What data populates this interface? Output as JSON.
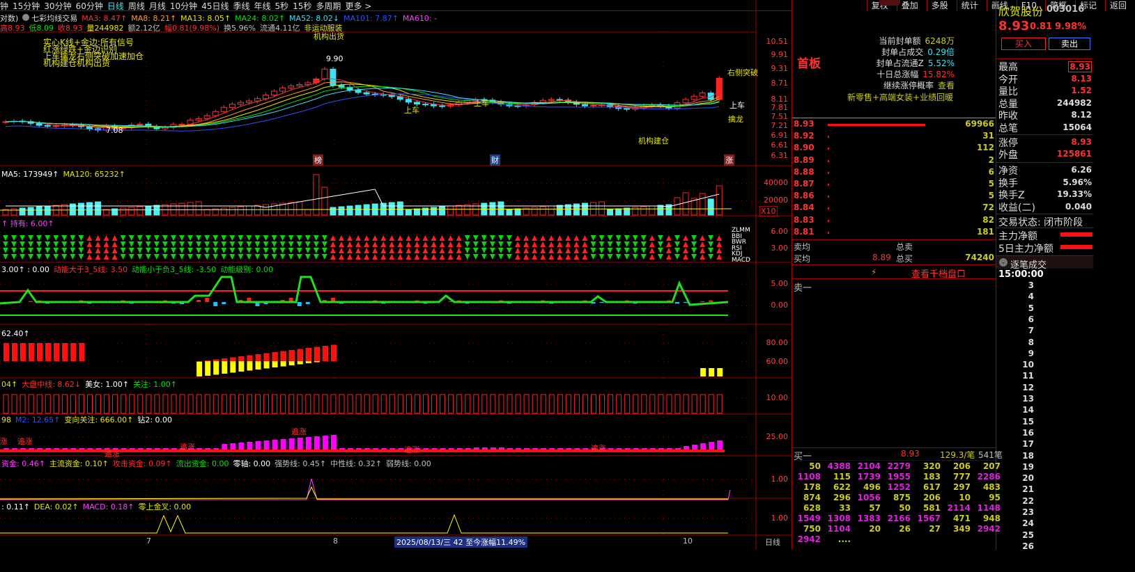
{
  "toolbar": {
    "periods": [
      "钟",
      "15分钟",
      "30分钟",
      "60分钟",
      "日线",
      "周线",
      "月线",
      "10分钟",
      "45日线",
      "季线",
      "年线",
      "5秒",
      "15秒",
      "多周期",
      "更多 >"
    ],
    "active": "日线",
    "tools": [
      "复权",
      "叠加",
      "多股",
      "统计",
      "画线",
      "F10",
      "简框",
      "标记",
      "返回"
    ]
  },
  "ma_line": {
    "prefix": "对数)",
    "indicator": "七彩均线交易",
    "items": [
      {
        "t": "MA3: 8.47↑",
        "c": "#ff3232"
      },
      {
        "t": "MA8: 8.21↑",
        "c": "#ff9a30"
      },
      {
        "t": "MA13: 8.05↑",
        "c": "#e6e600"
      },
      {
        "t": "MA24: 8.02↑",
        "c": "#00e600"
      },
      {
        "t": "MA52: 8.02↓",
        "c": "#40e0f0"
      },
      {
        "t": "MA101: 7.87↑",
        "c": "#3050ff"
      },
      {
        "t": "MA610: -",
        "c": "#ff40ff"
      }
    ]
  },
  "quote_line": [
    {
      "t": "高8.93",
      "c": "#ff3232"
    },
    {
      "t": "低8.09",
      "c": "#00e600"
    },
    {
      "t": "收8.93",
      "c": "#ff3232"
    },
    {
      "t": "量244982",
      "c": "#e6e600"
    },
    {
      "t": "额2.12亿",
      "c": "#c0c0c0"
    },
    {
      "t": "幅0.81(9.98%)",
      "c": "#ff3232"
    },
    {
      "t": "换5.96%",
      "c": "#c0c0c0"
    },
    {
      "t": "流通4.11亿",
      "c": "#c0c0c0"
    },
    {
      "t": "非运动服装",
      "c": "#e6e600"
    }
  ],
  "legend_notes": [
    "实心K线+金边:所有信号",
    "红涨绿跌+金边识别",
    "上车擒龙右侧突破加速加仓",
    "机构建仓机构出货"
  ],
  "annotations": {
    "high": "9.90",
    "low": "7.08",
    "top_label": "机构出货",
    "shangche1": "上车",
    "shangche2": "上车",
    "shangche3": "上车",
    "right_break": "右侧突破",
    "qinlong": "擒龙",
    "jigou": "机构建仓",
    "markers": [
      "榜",
      "财",
      "涨"
    ]
  },
  "price_axis": [
    "10.51",
    "9.91",
    "9.31",
    "8.71",
    "8.11",
    "7.81",
    "7.51",
    "7.21",
    "6.91",
    "6.61",
    "6.31"
  ],
  "panels": {
    "vol": {
      "header": [
        {
          "t": "MA5: 173949↑",
          "c": "#fff"
        },
        {
          "t": "MA120: 65232↑",
          "c": "#e6e600"
        }
      ],
      "axis": [
        "40000",
        "20000"
      ],
      "unit": "X10"
    },
    "hold": {
      "header": [
        {
          "t": "↑ 持有: 6.00↑",
          "c": "#ff40ff"
        }
      ],
      "axis": [
        "6.00",
        "3.00"
      ],
      "tags": [
        "ZLMM",
        "BBI",
        "BWR",
        "RSI",
        "KDJ",
        "MACD"
      ]
    },
    "energy": {
      "header": [
        {
          "t": "3.00↑ : 0.00",
          "c": "#fff"
        },
        {
          "t": "动能大于3_5线: 3.50",
          "c": "#ff3232"
        },
        {
          "t": "动能小于负3_5线: -3.50",
          "c": "#00e600"
        },
        {
          "t": "动能级别: 0.00",
          "c": "#00e600"
        }
      ],
      "axis": [
        "5.00",
        "0.00"
      ]
    },
    "p62": {
      "header": [
        {
          "t": "62.40↑",
          "c": "#fff"
        }
      ],
      "axis": [
        "80.00",
        "60.00"
      ]
    },
    "dapan": {
      "header": [
        {
          "t": "04↑",
          "c": "#e6e600"
        },
        {
          "t": "大盘中线: 8.62↓",
          "c": "#ff3232"
        },
        {
          "t": "美女: 1.00↑",
          "c": "#fff"
        },
        {
          "t": "关注: 1.00↑",
          "c": "#00e600"
        }
      ],
      "axis": [
        "10.00"
      ]
    },
    "m2": {
      "header": [
        {
          "t": "98",
          "c": "#e6e600"
        },
        {
          "t": "M2: 12.65↑",
          "c": "#3050ff"
        },
        {
          "t": "变向关注: 666.00↑",
          "c": "#e6e600"
        },
        {
          "t": "钻2: 0.00",
          "c": "#fff"
        }
      ],
      "axis": [
        "25.00"
      ],
      "labels": [
        "涨",
        "追涨",
        "追涨",
        "追涨",
        "追涨",
        "追涨",
        "追涨"
      ]
    },
    "fund": {
      "header": [
        {
          "t": "资金: 0.46↑",
          "c": "#ff40ff"
        },
        {
          "t": "主流资金: 0.10↑",
          "c": "#e6e600"
        },
        {
          "t": "攻击资金: 0.09↑",
          "c": "#ff3232"
        },
        {
          "t": "流出资金: 0.00",
          "c": "#00e600"
        },
        {
          "t": "零轴: 0.00",
          "c": "#fff"
        },
        {
          "t": "强势线: 0.45↑",
          "c": "#c0c0c0"
        },
        {
          "t": "中性线: 0.32↑",
          "c": "#c0c0c0"
        },
        {
          "t": "弱势线: 0.00",
          "c": "#c0c0c0"
        }
      ],
      "axis": [
        "1.00"
      ]
    },
    "macd": {
      "header": [
        {
          "t": ": 0.11↑",
          "c": "#fff"
        },
        {
          "t": "DEA: 0.02↑",
          "c": "#e6e600"
        },
        {
          "t": "MACD: 0.18↑",
          "c": "#ff40ff"
        },
        {
          "t": "零上金叉: 0.00",
          "c": "#e6e600"
        }
      ],
      "axis": [
        "1.00"
      ]
    }
  },
  "xaxis": {
    "labels": [
      "7",
      "8",
      "10"
    ],
    "status": "2025/08/13/三 42 至今涨幅11.49%",
    "period": "日线"
  },
  "board": {
    "title": "首板",
    "info": [
      {
        "k": "当前封单额",
        "v": "6248万",
        "c": "#cccc20"
      },
      {
        "k": "封单占成交",
        "v": "0.29倍",
        "c": "#40e0f0"
      },
      {
        "k": "封单占流通Z",
        "v": "5.52%",
        "c": "#40e0f0"
      },
      {
        "k": "十日总涨幅",
        "v": "15.82%",
        "c": "#ff3232"
      },
      {
        "k": "继续涨停概率",
        "v": "查看",
        "c": "#cccc20"
      }
    ],
    "theme": "新零售+高端女装+业绩回暖"
  },
  "orderbook": {
    "rows": [
      [
        "8.93",
        "69966"
      ],
      [
        "8.92",
        "31"
      ],
      [
        "8.90",
        "112"
      ],
      [
        "8.89",
        "2"
      ],
      [
        "8.88",
        "6"
      ],
      [
        "8.87",
        "5"
      ],
      [
        "8.86",
        "5"
      ],
      [
        "8.84",
        "72"
      ],
      [
        "8.83",
        "82"
      ],
      [
        "8.81",
        "181"
      ]
    ],
    "sell_avg": "卖均",
    "total_sell": "总卖",
    "buy_avg": "买均",
    "buy_avg_val": "8.89",
    "total_buy": "总买",
    "total_buy_val": "74240",
    "deep_link": "查看千档盘口",
    "sell1": "卖一",
    "buy1": "买一",
    "buy1_price": "8.93",
    "buy1_avg": "129.3/笔",
    "buy1_count": "541笔",
    "queue": [
      [
        "50",
        "4388",
        "2104",
        "2279",
        "320",
        "206",
        "207"
      ],
      [
        "1108",
        "115",
        "1739",
        "1955",
        "183",
        "777",
        "2286"
      ],
      [
        "178",
        "622",
        "496",
        "1252",
        "617",
        "297",
        "483"
      ],
      [
        "874",
        "296",
        "1056",
        "875",
        "206",
        "10",
        "95"
      ],
      [
        "628",
        "33",
        "57",
        "50",
        "581",
        "2114",
        "1148"
      ],
      [
        "1549",
        "1308",
        "1383",
        "2166",
        "1567",
        "471",
        "948"
      ],
      [
        "750",
        "1104",
        "20",
        "26",
        "27",
        "349",
        "2942"
      ],
      [
        "2942",
        "...."
      ]
    ]
  },
  "stock": {
    "name": "欣贺股份",
    "code": "003016",
    "price": "8.93",
    "change": "0.81",
    "pct": "9.98%",
    "buy": "买入",
    "sell": "卖出",
    "stats": [
      {
        "k": "最高",
        "v": "8.93",
        "c": "#ff3232",
        "box": true
      },
      {
        "k": "今开",
        "v": "8.13",
        "c": "#ff3232"
      },
      {
        "k": "量比",
        "v": "1.52",
        "c": "#ff3232"
      },
      {
        "k": "总量",
        "v": "244982",
        "c": "#ddd"
      },
      {
        "k": "昨收",
        "v": "8.12",
        "c": "#ddd"
      },
      {
        "k": "总笔",
        "v": "15064",
        "c": "#ddd"
      },
      {
        "k": "涨停",
        "v": "8.93",
        "c": "#ff3232"
      },
      {
        "k": "外盘",
        "v": "125861",
        "c": "#ff3232"
      },
      {
        "k": "净资",
        "v": "6.26",
        "c": "#ddd"
      },
      {
        "k": "换手",
        "v": "5.96%",
        "c": "#ddd"
      },
      {
        "k": "换手Z",
        "v": "19.33%",
        "c": "#ddd"
      },
      {
        "k": "收益(二)",
        "v": "0.040",
        "c": "#ddd"
      }
    ],
    "trade_status": "交易状态: 闭市阶段",
    "main_net": "主力净额",
    "main_net_5d": "5日主力净额",
    "ticks_title": "逐笔成交",
    "tick_time": "15:00:00",
    "ticks": [
      "3",
      "4",
      "5",
      "6",
      "7",
      "8",
      "9",
      "10",
      "11",
      "12",
      "13",
      "14",
      "15",
      "16",
      "17",
      "18",
      "19",
      "20",
      "21",
      "22",
      "23",
      "24",
      "25",
      "26"
    ]
  }
}
